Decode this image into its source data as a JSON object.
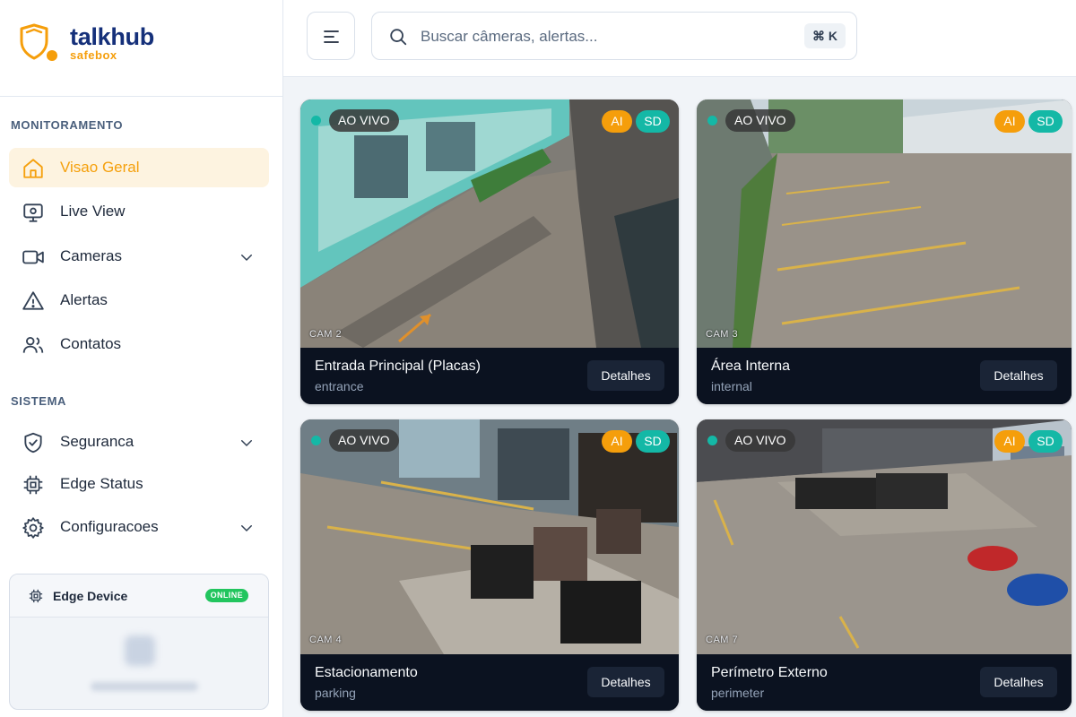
{
  "brand": {
    "name": "talkhub",
    "sub": "safebox",
    "primary": "#15307a",
    "accent": "#f59e0b"
  },
  "sidebar": {
    "sections": [
      {
        "title": "MONITORAMENTO"
      },
      {
        "title": "SISTEMA"
      }
    ],
    "items": [
      {
        "label": "Visao Geral",
        "icon": "home-icon",
        "active": true
      },
      {
        "label": "Live View",
        "icon": "monitor-icon"
      },
      {
        "label": "Cameras",
        "icon": "video-icon",
        "expandable": true
      },
      {
        "label": "Alertas",
        "icon": "alert-triangle-icon"
      },
      {
        "label": "Contatos",
        "icon": "users-icon"
      },
      {
        "label": "Seguranca",
        "icon": "shield-check-icon",
        "expandable": true
      },
      {
        "label": "Edge Status",
        "icon": "cpu-icon"
      },
      {
        "label": "Configuracoes",
        "icon": "gear-icon",
        "expandable": true
      }
    ],
    "edge_device": {
      "title": "Edge Device",
      "status": "ONLINE",
      "status_color": "#22c55e"
    }
  },
  "topbar": {
    "search_placeholder": "Buscar câmeras, alertas...",
    "shortcut": "⌘ K"
  },
  "cameras": [
    {
      "name": "Entrada Principal (Placas)",
      "type": "entrance",
      "id": "CAM 2",
      "live": "AO VIVO",
      "ai": "AI",
      "quality": "SD",
      "details": "Detalhes"
    },
    {
      "name": "Área Interna",
      "type": "internal",
      "id": "CAM 3",
      "live": "AO VIVO",
      "ai": "AI",
      "quality": "SD",
      "details": "Detalhes"
    },
    {
      "name": "Estacionamento",
      "type": "parking",
      "id": "CAM 4",
      "live": "AO VIVO",
      "ai": "AI",
      "quality": "SD",
      "details": "Detalhes"
    },
    {
      "name": "Perímetro Externo",
      "type": "perimeter",
      "id": "CAM 7",
      "live": "AO VIVO",
      "ai": "AI",
      "quality": "SD",
      "details": "Detalhes"
    }
  ],
  "colors": {
    "live_dot": "#14b8a6",
    "ai_badge": "#f59e0b",
    "sd_badge": "#14b8a6",
    "active_nav": "#f5a00c"
  }
}
